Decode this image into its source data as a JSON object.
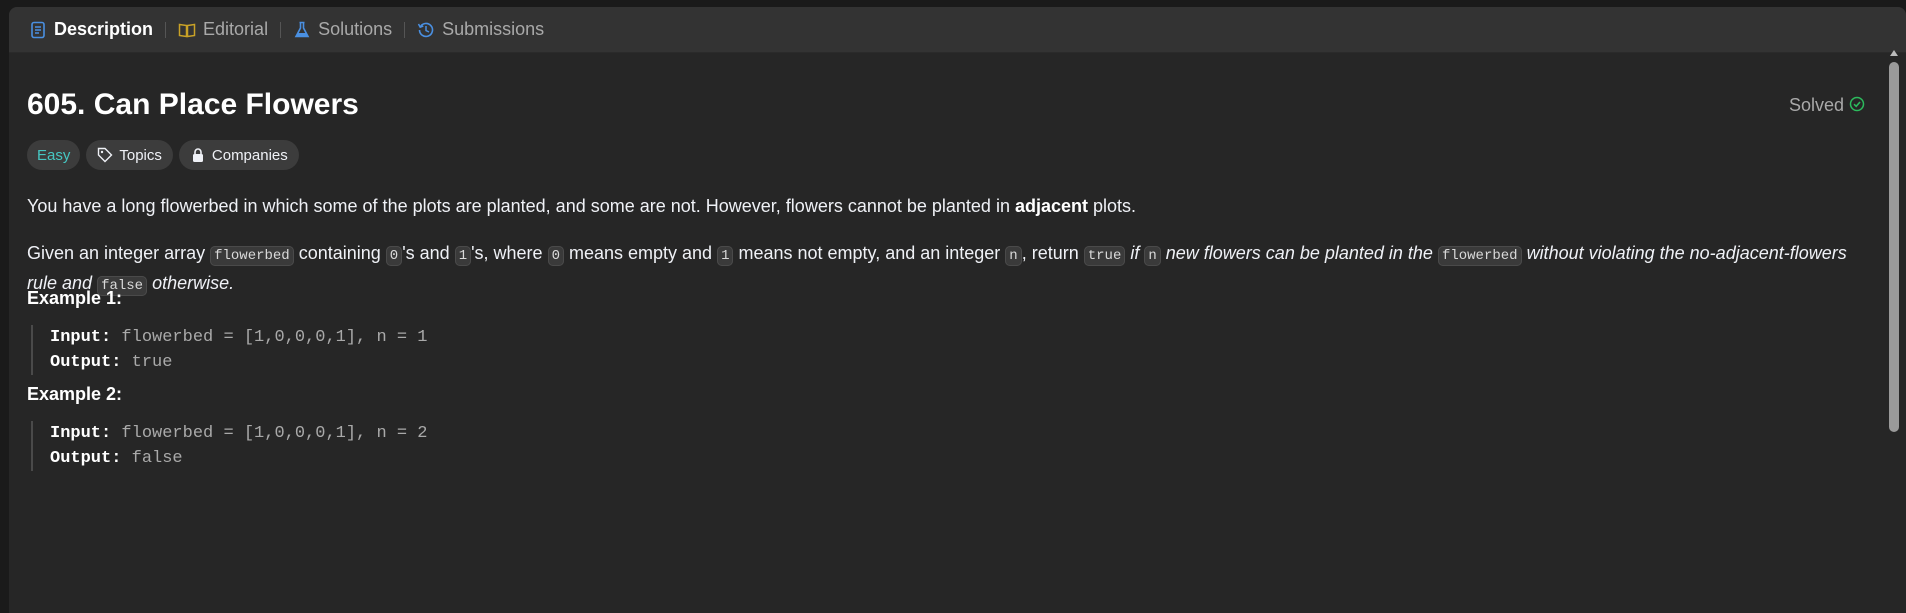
{
  "tabs": [
    {
      "label": "Description",
      "icon": "description-icon",
      "color": "#4a90e2"
    },
    {
      "label": "Editorial",
      "icon": "book-icon",
      "color": "#c9a227"
    },
    {
      "label": "Solutions",
      "icon": "flask-icon",
      "color": "#4a90e2"
    },
    {
      "label": "Submissions",
      "icon": "history-icon",
      "color": "#4a90e2"
    }
  ],
  "problem": {
    "title": "605. Can Place Flowers",
    "status": "Solved",
    "difficulty": "Easy",
    "topics_label": "Topics",
    "companies_label": "Companies"
  },
  "description": {
    "p1_before": "You have a long flowerbed in which some of the plots are planted, and some are not. However, flowers cannot be planted in ",
    "p1_bold": "adjacent",
    "p1_after": " plots.",
    "p2": {
      "t1": "Given an integer array ",
      "c1": "flowerbed",
      "t2": " containing ",
      "c2": "0",
      "t3": "'s and ",
      "c3": "1",
      "t4": "'s, where ",
      "c4": "0",
      "t5": " means empty and ",
      "c5": "1",
      "t6": " means not empty, and an integer ",
      "c6": "n",
      "t7": ", return ",
      "c7": "true",
      "i1": " if ",
      "c8": "n",
      "i2": " new flowers can be planted in the ",
      "c9": "flowerbed",
      "i3": " without violating the no-adjacent-flowers rule and ",
      "c10": "false",
      "i4": " otherwise."
    }
  },
  "examples": [
    {
      "title": "Example 1:",
      "input_label": "Input:",
      "input": "flowerbed = [1,0,0,0,1], n = 1",
      "output_label": "Output:",
      "output": "true"
    },
    {
      "title": "Example 2:",
      "input_label": "Input:",
      "input": "flowerbed = [1,0,0,0,1], n = 2",
      "output_label": "Output:",
      "output": "false"
    }
  ],
  "colors": {
    "easy": "#46c6c2",
    "solved_check": "#2cbb5d",
    "background": "#262626",
    "tabbar": "#333333"
  }
}
